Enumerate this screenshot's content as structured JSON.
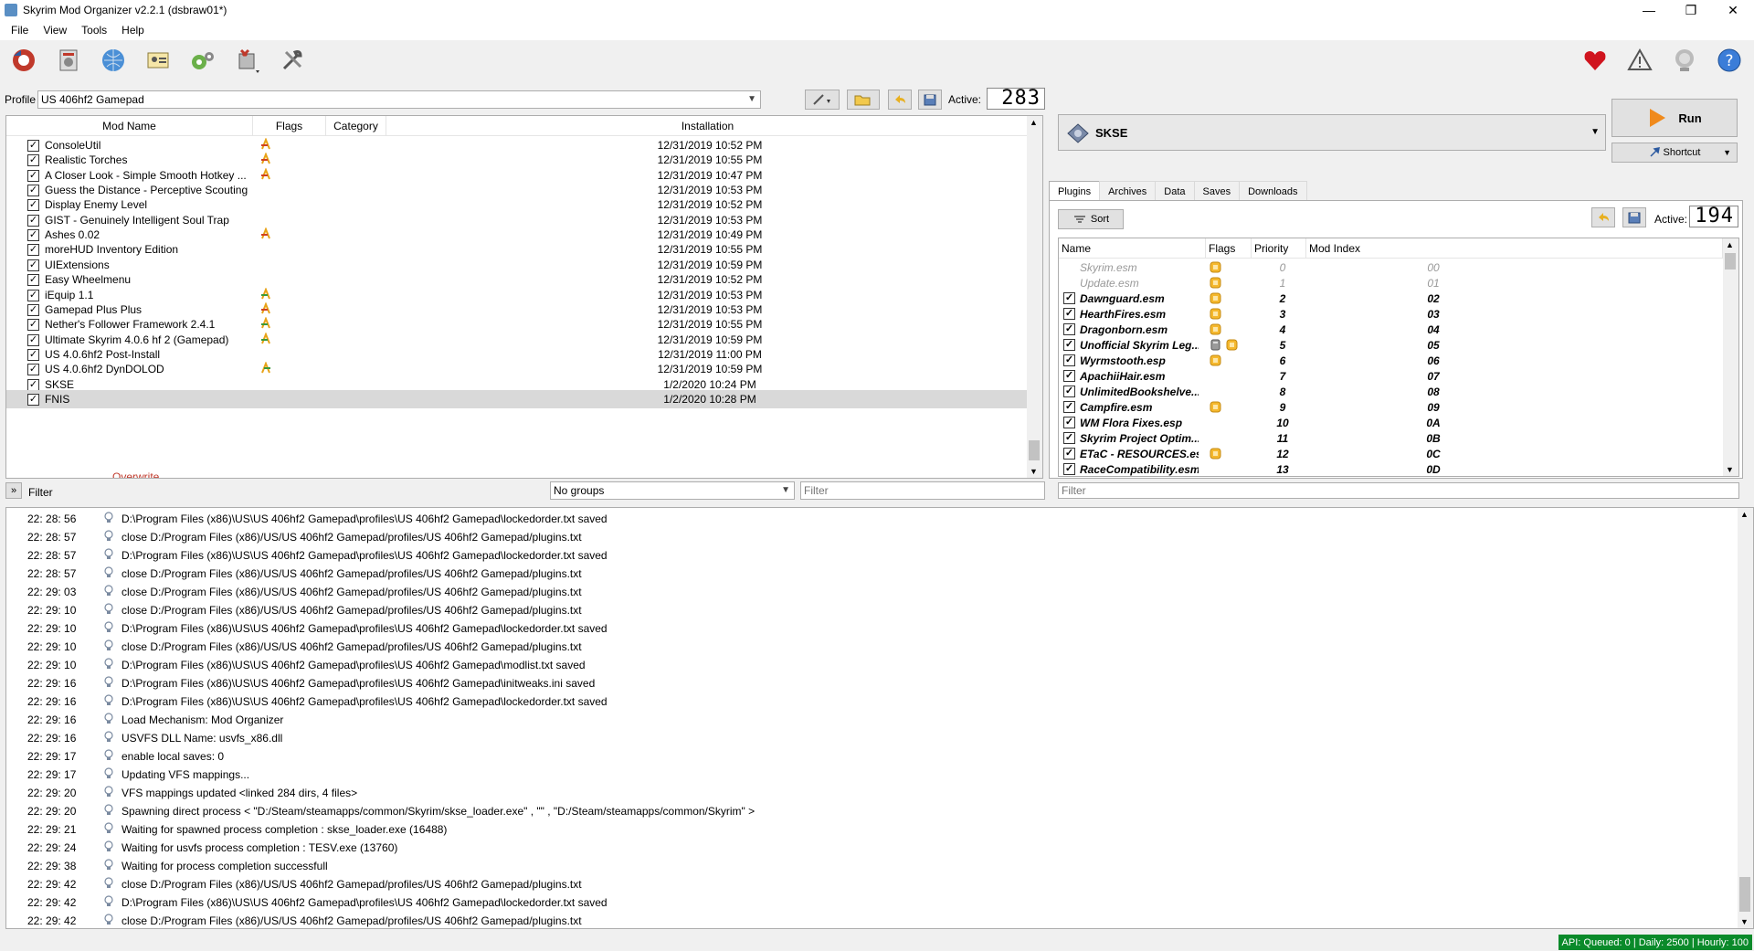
{
  "window": {
    "title": "Skyrim Mod Organizer v2.2.1 (dsbraw01*)",
    "minimize": "—",
    "maximize": "❐",
    "close": "✕"
  },
  "menu": [
    "File",
    "View",
    "Tools",
    "Help"
  ],
  "toolbar_icons": [
    "change-game-icon",
    "install-mod-icon",
    "nexus-icon",
    "profiles-icon",
    "executables-icon",
    "tools-icon",
    "settings-icon",
    "endorse-icon",
    "problems-icon",
    "update-icon",
    "help-icon"
  ],
  "profile": {
    "label": "Profile",
    "value": "US 406hf2 Gamepad",
    "active_label": "Active:",
    "active_count": "283"
  },
  "modlist": {
    "headers": {
      "name": "Mod Name",
      "flags": "Flags",
      "category": "Category",
      "installation": "Installation"
    },
    "rows": [
      {
        "name": "ConsoleUtil",
        "checked": true,
        "flag": "conflict",
        "installed": "12/31/2019 10:52 PM"
      },
      {
        "name": "Realistic Torches",
        "checked": true,
        "flag": "conflict",
        "installed": "12/31/2019 10:55 PM"
      },
      {
        "name": "A Closer Look - Simple Smooth Hotkey ...",
        "checked": true,
        "flag": "conflict",
        "installed": "12/31/2019 10:47 PM"
      },
      {
        "name": "Guess the Distance - Perceptive Scouting",
        "checked": true,
        "flag": "",
        "installed": "12/31/2019 10:53 PM"
      },
      {
        "name": "Display Enemy Level",
        "checked": true,
        "flag": "",
        "installed": "12/31/2019 10:52 PM"
      },
      {
        "name": "GIST - Genuinely Intelligent Soul Trap",
        "checked": true,
        "flag": "",
        "installed": "12/31/2019 10:53 PM"
      },
      {
        "name": "Ashes 0.02",
        "checked": true,
        "flag": "conflict",
        "installed": "12/31/2019 10:49 PM"
      },
      {
        "name": "moreHUD Inventory Edition",
        "checked": true,
        "flag": "",
        "installed": "12/31/2019 10:55 PM"
      },
      {
        "name": "UIExtensions",
        "checked": true,
        "flag": "",
        "installed": "12/31/2019 10:59 PM"
      },
      {
        "name": "Easy Wheelmenu",
        "checked": true,
        "flag": "",
        "installed": "12/31/2019 10:52 PM"
      },
      {
        "name": "iEquip 1.1",
        "checked": true,
        "flag": "conflict-mixed",
        "installed": "12/31/2019 10:53 PM"
      },
      {
        "name": "Gamepad Plus Plus",
        "checked": true,
        "flag": "conflict",
        "installed": "12/31/2019 10:53 PM"
      },
      {
        "name": "Nether's Follower Framework 2.4.1",
        "checked": true,
        "flag": "conflict-mixed",
        "installed": "12/31/2019 10:55 PM"
      },
      {
        "name": "Ultimate Skyrim 4.0.6 hf 2 (Gamepad)",
        "checked": true,
        "flag": "conflict-mixed",
        "installed": "12/31/2019 10:59 PM"
      },
      {
        "name": "US 4.0.6hf2 Post-Install",
        "checked": true,
        "flag": "",
        "installed": "12/31/2019 11:00 PM"
      },
      {
        "name": "US 4.0.6hf2 DynDOLOD",
        "checked": true,
        "flag": "conflict-win",
        "installed": "12/31/2019 10:59 PM"
      },
      {
        "name": "SKSE",
        "checked": true,
        "flag": "",
        "installed": "1/2/2020 10:24 PM"
      },
      {
        "name": "FNIS",
        "checked": true,
        "flag": "",
        "installed": "1/2/2020 10:28 PM",
        "selected": true
      }
    ],
    "overwrite": "Overwrite"
  },
  "filter_row": {
    "toggle": "»",
    "label": "Filter",
    "groups": "No groups",
    "filter_placeholder": "Filter"
  },
  "executable": {
    "name": "SKSE",
    "run": "Run",
    "shortcut": "Shortcut"
  },
  "tabs": [
    "Plugins",
    "Archives",
    "Data",
    "Saves",
    "Downloads"
  ],
  "plugins": {
    "sort": "Sort",
    "active_label": "Active:",
    "active_count": "194",
    "headers": {
      "name": "Name",
      "flags": "Flags",
      "priority": "Priority",
      "mod_index": "Mod Index"
    },
    "rows": [
      {
        "name": "Skyrim.esm",
        "checked": false,
        "flags": [
          "master"
        ],
        "priority": "0",
        "index": "00",
        "dim": true
      },
      {
        "name": "Update.esm",
        "checked": false,
        "flags": [
          "master"
        ],
        "priority": "1",
        "index": "01",
        "dim": true
      },
      {
        "name": "Dawnguard.esm",
        "checked": true,
        "flags": [
          "master"
        ],
        "priority": "2",
        "index": "02"
      },
      {
        "name": "HearthFires.esm",
        "checked": true,
        "flags": [
          "master"
        ],
        "priority": "3",
        "index": "03"
      },
      {
        "name": "Dragonborn.esm",
        "checked": true,
        "flags": [
          "master"
        ],
        "priority": "4",
        "index": "04"
      },
      {
        "name": "Unofficial Skyrim Leg...",
        "checked": true,
        "flags": [
          "archive",
          "master"
        ],
        "priority": "5",
        "index": "05"
      },
      {
        "name": "Wyrmstooth.esp",
        "checked": true,
        "flags": [
          "master"
        ],
        "priority": "6",
        "index": "06"
      },
      {
        "name": "ApachiiHair.esm",
        "checked": true,
        "flags": [],
        "priority": "7",
        "index": "07"
      },
      {
        "name": "UnlimitedBookshelve...",
        "checked": true,
        "flags": [],
        "priority": "8",
        "index": "08"
      },
      {
        "name": "Campfire.esm",
        "checked": true,
        "flags": [
          "master"
        ],
        "priority": "9",
        "index": "09"
      },
      {
        "name": "WM Flora Fixes.esp",
        "checked": true,
        "flags": [],
        "priority": "10",
        "index": "0A"
      },
      {
        "name": "Skyrim Project Optim...",
        "checked": true,
        "flags": [],
        "priority": "11",
        "index": "0B"
      },
      {
        "name": "ETaC - RESOURCES.esm",
        "checked": true,
        "flags": [
          "master"
        ],
        "priority": "12",
        "index": "0C"
      },
      {
        "name": "RaceCompatibility.esm",
        "checked": true,
        "flags": [],
        "priority": "13",
        "index": "0D"
      }
    ],
    "filter_placeholder": "Filter"
  },
  "log": [
    {
      "time": "22: 28: 56",
      "msg": "D:\\Program Files (x86)\\US\\US 406hf2 Gamepad\\profiles\\US 406hf2 Gamepad\\lockedorder.txt saved"
    },
    {
      "time": "22: 28: 57",
      "msg": "close D:/Program Files (x86)/US/US 406hf2 Gamepad/profiles/US 406hf2 Gamepad/plugins.txt"
    },
    {
      "time": "22: 28: 57",
      "msg": "D:\\Program Files (x86)\\US\\US 406hf2 Gamepad\\profiles\\US 406hf2 Gamepad\\lockedorder.txt saved"
    },
    {
      "time": "22: 28: 57",
      "msg": "close D:/Program Files (x86)/US/US 406hf2 Gamepad/profiles/US 406hf2 Gamepad/plugins.txt"
    },
    {
      "time": "22: 29: 03",
      "msg": "close D:/Program Files (x86)/US/US 406hf2 Gamepad/profiles/US 406hf2 Gamepad/plugins.txt"
    },
    {
      "time": "22: 29: 10",
      "msg": "close D:/Program Files (x86)/US/US 406hf2 Gamepad/profiles/US 406hf2 Gamepad/plugins.txt"
    },
    {
      "time": "22: 29: 10",
      "msg": "D:\\Program Files (x86)\\US\\US 406hf2 Gamepad\\profiles\\US 406hf2 Gamepad\\lockedorder.txt saved"
    },
    {
      "time": "22: 29: 10",
      "msg": "close D:/Program Files (x86)/US/US 406hf2 Gamepad/profiles/US 406hf2 Gamepad/plugins.txt"
    },
    {
      "time": "22: 29: 10",
      "msg": "D:\\Program Files (x86)\\US\\US 406hf2 Gamepad\\profiles\\US 406hf2 Gamepad\\modlist.txt saved"
    },
    {
      "time": "22: 29: 16",
      "msg": "D:\\Program Files (x86)\\US\\US 406hf2 Gamepad\\profiles\\US 406hf2 Gamepad\\initweaks.ini saved"
    },
    {
      "time": "22: 29: 16",
      "msg": "D:\\Program Files (x86)\\US\\US 406hf2 Gamepad\\profiles\\US 406hf2 Gamepad\\lockedorder.txt saved"
    },
    {
      "time": "22: 29: 16",
      "msg": "Load Mechanism: Mod Organizer"
    },
    {
      "time": "22: 29: 16",
      "msg": "USVFS DLL Name: usvfs_x86.dll"
    },
    {
      "time": "22: 29: 17",
      "msg": "enable local saves: 0"
    },
    {
      "time": "22: 29: 17",
      "msg": "Updating VFS mappings..."
    },
    {
      "time": "22: 29: 20",
      "msg": "VFS mappings updated <linked 284 dirs, 4 files>"
    },
    {
      "time": "22: 29: 20",
      "msg": "Spawning direct process < \"D:/Steam/steamapps/common/Skyrim/skse_loader.exe\" , \"\" , \"D:/Steam/steamapps/common/Skyrim\" >"
    },
    {
      "time": "22: 29: 21",
      "msg": "Waiting for spawned process completion : skse_loader.exe (16488)"
    },
    {
      "time": "22: 29: 24",
      "msg": "Waiting for usvfs process completion : TESV.exe (13760)"
    },
    {
      "time": "22: 29: 38",
      "msg": "Waiting for process completion successfull"
    },
    {
      "time": "22: 29: 42",
      "msg": "close D:/Program Files (x86)/US/US 406hf2 Gamepad/profiles/US 406hf2 Gamepad/plugins.txt"
    },
    {
      "time": "22: 29: 42",
      "msg": "D:\\Program Files (x86)\\US\\US 406hf2 Gamepad\\profiles\\US 406hf2 Gamepad\\lockedorder.txt saved"
    },
    {
      "time": "22: 29: 42",
      "msg": "close D:/Program Files (x86)/US/US 406hf2 Gamepad/profiles/US 406hf2 Gamepad/plugins.txt"
    }
  ],
  "status": {
    "api": "API: Queued: 0 | Daily: 2500 | Hourly: 100"
  },
  "colors": {
    "accent_green": "#0a8a2a",
    "flag_orange": "#e8a317",
    "run_orange": "#f08a1c"
  }
}
